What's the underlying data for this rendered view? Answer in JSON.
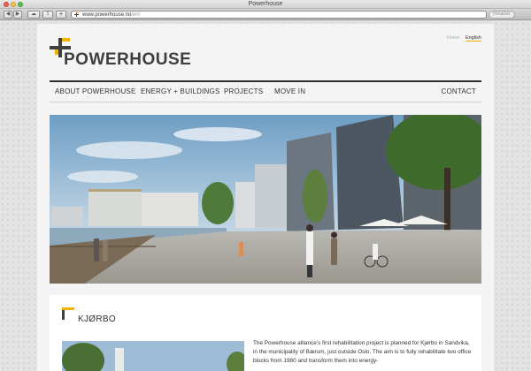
{
  "browser": {
    "window_title": "Powerhouse",
    "url_host": "www.powerhouse.no",
    "url_path": "/en/",
    "reader_label": "Reader",
    "add_label": "+"
  },
  "site": {
    "brand": "POWERHOUSE",
    "lang": {
      "home": "Home",
      "english": "English"
    },
    "nav": [
      {
        "label": "ABOUT POWERHOUSE"
      },
      {
        "label": "ENERGY + BUILDINGS"
      },
      {
        "label": "PROJECTS"
      },
      {
        "label": "MOVE IN"
      },
      {
        "label": "CONTACT"
      }
    ],
    "section": {
      "title": "KJØRBO",
      "body": "The Powerhouse alliance's first rehabilitation project is planned for Kjørbo in Sandvika, in the municipality of Bærum, just outside Oslo. The aim is to fully rehabilitate two office blocks from 1980 and transform them into energy-"
    }
  },
  "colors": {
    "accent_yellow": "#f2b400",
    "logo_grey": "#3f3f3f",
    "nav_rule": "#2f2f2f"
  },
  "icons": {
    "back": "arrow-left-icon",
    "forward": "arrow-right-icon",
    "cloud": "cloud-icon",
    "share": "share-icon",
    "favicon": "powerhouse-favicon-icon"
  }
}
